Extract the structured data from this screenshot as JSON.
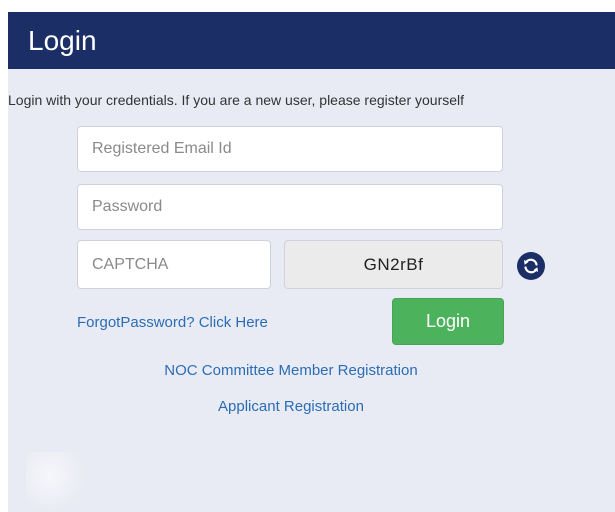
{
  "header": {
    "title": "Login"
  },
  "instructions": "Login with your credentials. If you are a new user, please register yourself",
  "form": {
    "email_placeholder": "Registered Email Id",
    "email_value": "",
    "password_placeholder": "Password",
    "password_value": "",
    "captcha_placeholder": "CAPTCHA",
    "captcha_value": "",
    "captcha_code": "GN2rBf",
    "refresh_icon": "refresh-icon",
    "login_label": "Login"
  },
  "links": {
    "forgot_password": "ForgotPassword? Click Here",
    "noc_registration": "NOC Committee Member Registration",
    "applicant_registration": "Applicant Registration"
  },
  "colors": {
    "header_bg": "#1c2e66",
    "panel_bg": "#e9ebf4",
    "login_button": "#4cb35c",
    "link": "#2a6db5"
  }
}
